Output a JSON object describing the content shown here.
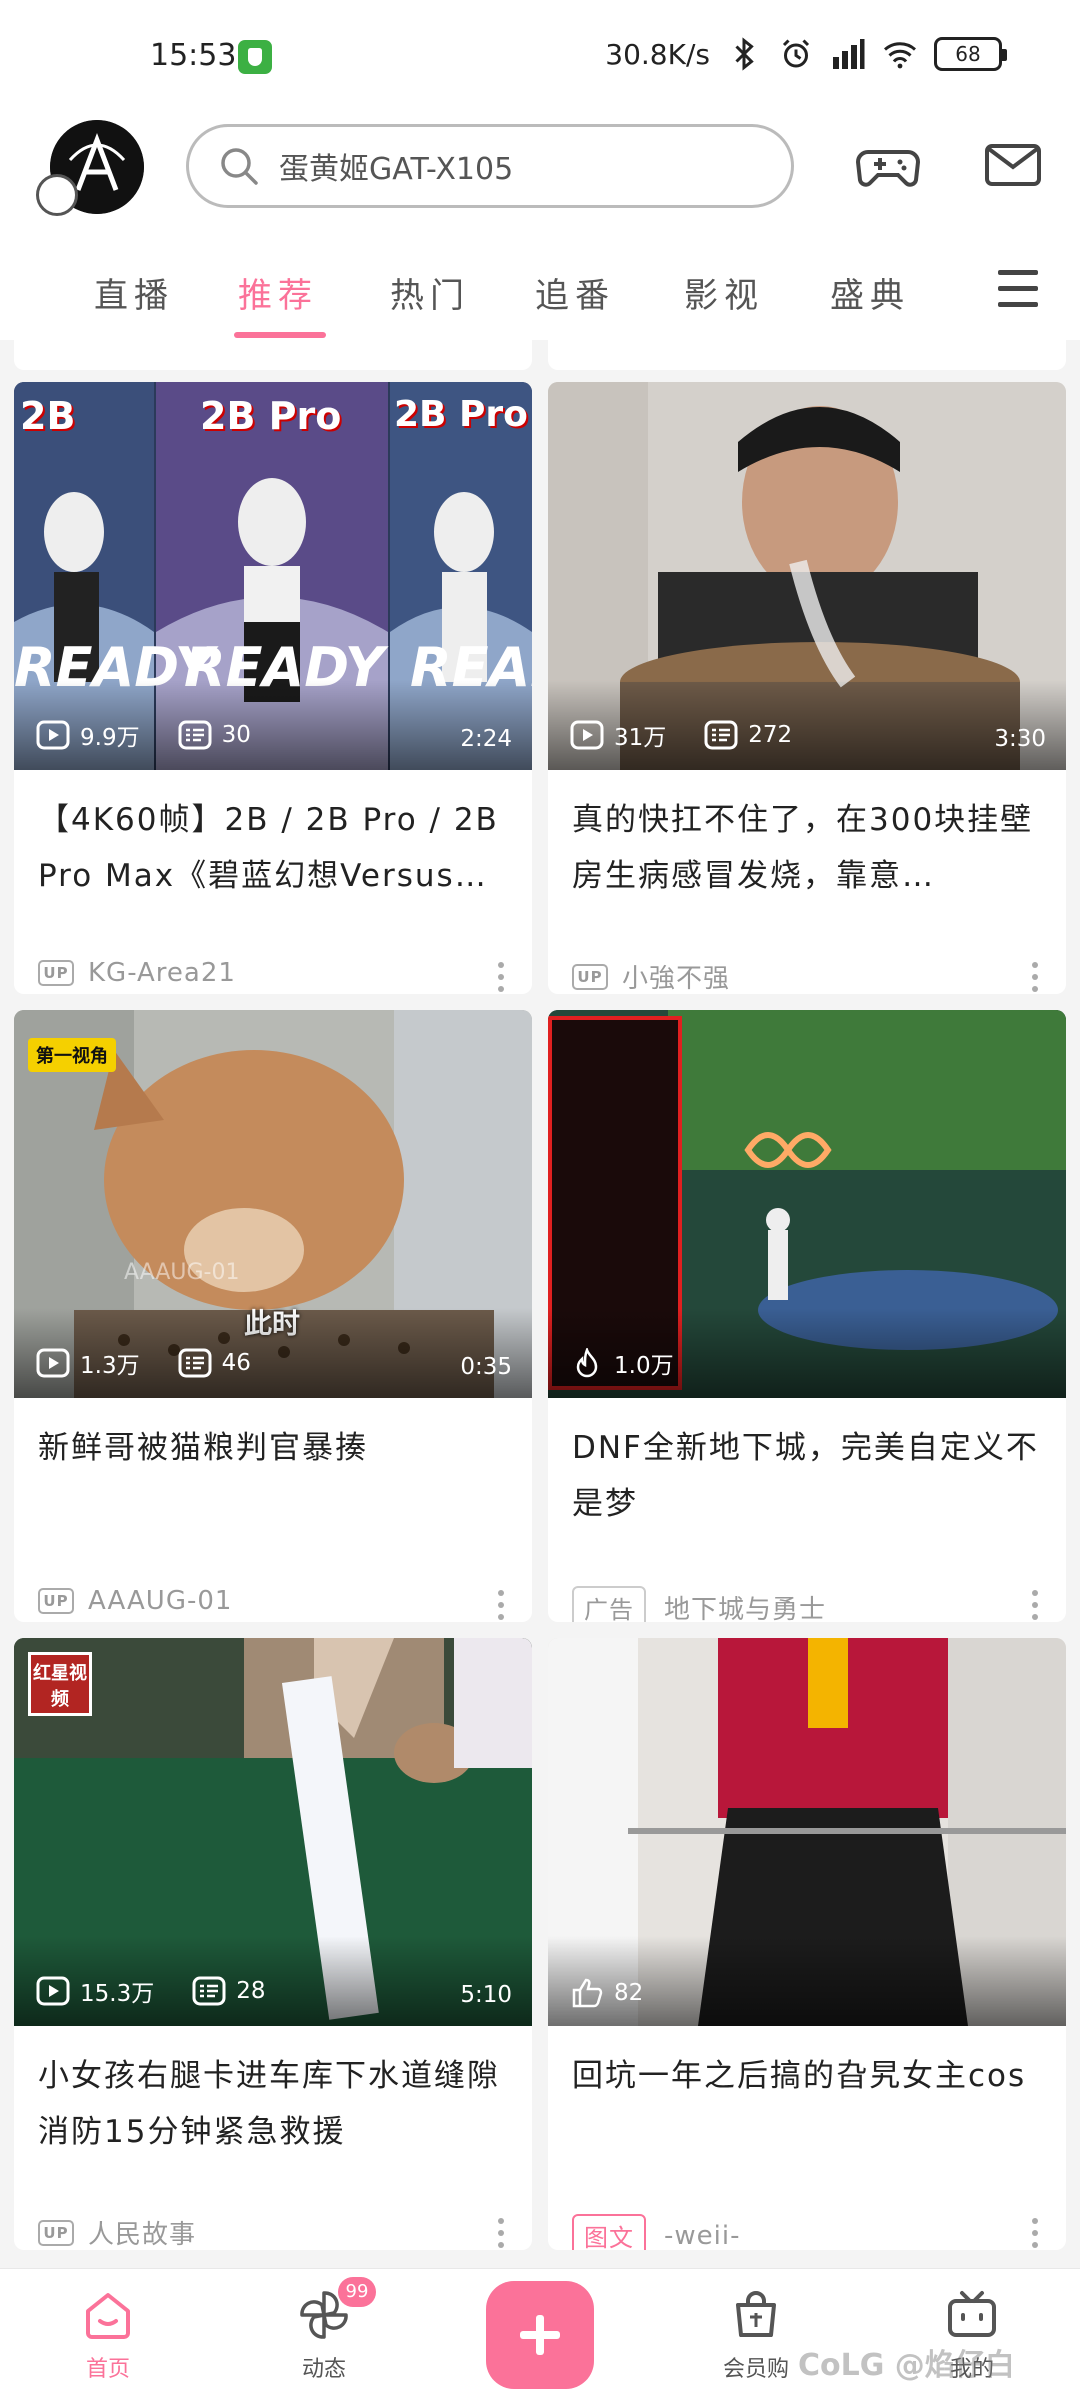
{
  "status_bar": {
    "time": "15:53",
    "net_speed": "30.8K/s",
    "battery": "68"
  },
  "header": {
    "search_placeholder": "蛋黄姬GAT-X105"
  },
  "tabs": [
    {
      "label": "直播"
    },
    {
      "label": "推荐",
      "active": true
    },
    {
      "label": "热门"
    },
    {
      "label": "追番"
    },
    {
      "label": "影视"
    },
    {
      "label": "盛典"
    }
  ],
  "cards": [
    {
      "views": "9.9万",
      "danmaku": "30",
      "duration": "2:24",
      "title": "【4K60帧】2B / 2B Pro / 2B Pro Max《碧蓝幻想Versus…",
      "author": "KG-Area21",
      "badge": "UP",
      "thumb_text": [
        "2B",
        "2B Pro",
        "2B Pro I",
        "READY"
      ]
    },
    {
      "views": "31万",
      "danmaku": "272",
      "duration": "3:30",
      "title": "真的快扛不住了，在300块挂壁房生病感冒发烧，靠意…",
      "author": "小強不强",
      "badge": "UP"
    },
    {
      "views": "1.3万",
      "danmaku": "46",
      "duration": "0:35",
      "title": "新鲜哥被猫粮判官暴揍",
      "author": "AAAUG-01",
      "badge": "UP",
      "corner_tag": "第一视角",
      "caption": "此时",
      "wm": "AAAUG-01"
    },
    {
      "hot": "1.0万",
      "title": "DNF全新地下城，完美自定义不是梦",
      "author": "地下城与勇士",
      "badge": "广告"
    },
    {
      "views": "15.3万",
      "danmaku": "28",
      "duration": "5:10",
      "title": "小女孩右腿卡进车库下水道缝隙 消防15分钟紧急救援",
      "author": "人民故事",
      "badge": "UP",
      "corner_logo": "红星视频"
    },
    {
      "likes": "82",
      "title": "回坑一年之后搞的旮旯女主cos",
      "author": "-weii-",
      "badge": "图文"
    }
  ],
  "bottom_nav": {
    "home": "首页",
    "dynamic": "动态",
    "dynamic_badge": "99",
    "mall": "会员购",
    "mine": "我的"
  },
  "watermark": "CoLG @焰仔白"
}
